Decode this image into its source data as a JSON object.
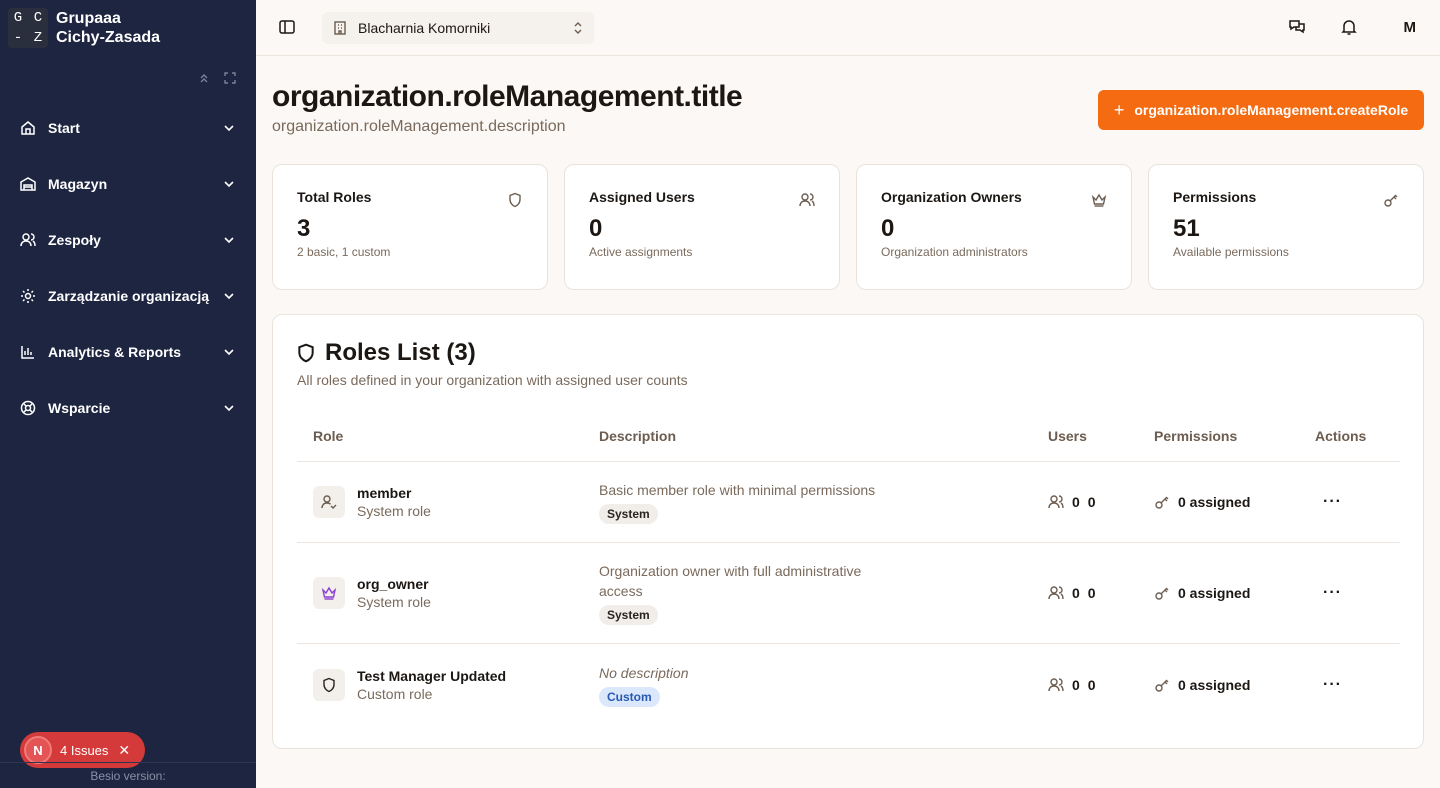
{
  "brand": {
    "logo": [
      "G",
      "C",
      "-",
      "Z"
    ],
    "name_line1": "Grupaaa",
    "name_line2": "Cichy-Zasada"
  },
  "sidebar": {
    "items": [
      {
        "label": "Start",
        "icon": "home-icon"
      },
      {
        "label": "Magazyn",
        "icon": "warehouse-icon"
      },
      {
        "label": "Zespoły",
        "icon": "users-icon"
      },
      {
        "label": "Zarządzanie organizacją",
        "icon": "gear-icon"
      },
      {
        "label": "Analytics & Reports",
        "icon": "chart-icon"
      },
      {
        "label": "Wsparcie",
        "icon": "lifebuoy-icon"
      }
    ],
    "version": "Besio version:"
  },
  "issues": {
    "badge": "N",
    "label": "4 Issues"
  },
  "topbar": {
    "org_name": "Blacharnia Komorniki",
    "avatar": "M"
  },
  "header": {
    "title": "organization.roleManagement.title",
    "description": "organization.roleManagement.description",
    "create_label": "organization.roleManagement.createRole"
  },
  "stats": [
    {
      "title": "Total Roles",
      "value": "3",
      "sub": "2 basic, 1 custom",
      "icon": "shield-icon"
    },
    {
      "title": "Assigned Users",
      "value": "0",
      "sub": "Active assignments",
      "icon": "users-icon"
    },
    {
      "title": "Organization Owners",
      "value": "0",
      "sub": "Organization administrators",
      "icon": "crown-icon"
    },
    {
      "title": "Permissions",
      "value": "51",
      "sub": "Available permissions",
      "icon": "key-icon"
    }
  ],
  "roles_panel": {
    "title": "Roles List (3)",
    "description": "All roles defined in your organization with assigned user counts",
    "columns": [
      "Role",
      "Description",
      "Users",
      "Permissions",
      "Actions"
    ],
    "rows": [
      {
        "name": "member",
        "type": "System role",
        "description": "Basic member role with minimal permissions",
        "badge": "System",
        "users_a": "0",
        "users_b": "0",
        "permissions": "0 assigned"
      },
      {
        "name": "org_owner",
        "type": "System role",
        "description": "Organization owner with full administrative access",
        "badge": "System",
        "users_a": "0",
        "users_b": "0",
        "permissions": "0 assigned"
      },
      {
        "name": "Test Manager Updated",
        "type": "Custom role",
        "description": "No description",
        "badge": "Custom",
        "users_a": "0",
        "users_b": "0",
        "permissions": "0 assigned"
      }
    ],
    "actions_glyph": "···"
  },
  "colors": {
    "sidebar_bg": "#1e2540",
    "accent": "#f46b12",
    "page_bg": "#fbf8f5",
    "issues_bg": "#d43a3a",
    "crown_purple": "#8a3fd1"
  }
}
